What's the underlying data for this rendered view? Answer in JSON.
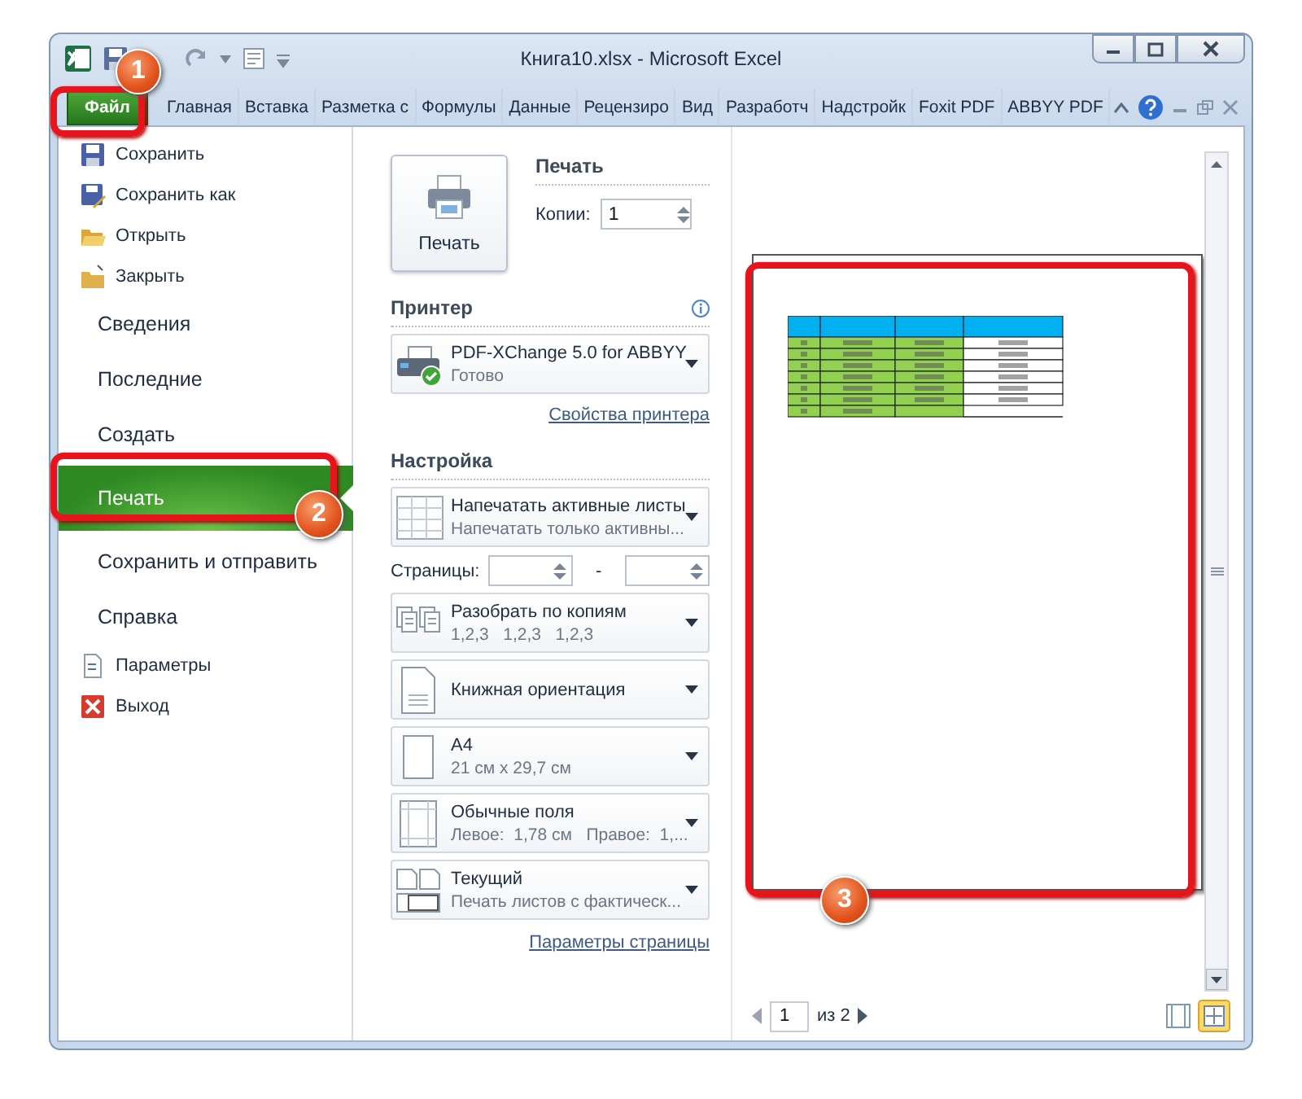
{
  "window": {
    "title": "Книга10.xlsx - Microsoft Excel"
  },
  "ribbon_tabs": [
    {
      "label": "Файл",
      "selected": true
    },
    {
      "label": "Главная",
      "selected": false
    },
    {
      "label": "Вставка",
      "selected": false
    },
    {
      "label": "Разметка с",
      "selected": false
    },
    {
      "label": "Формулы",
      "selected": false
    },
    {
      "label": "Данные",
      "selected": false
    },
    {
      "label": "Рецензиро",
      "selected": false
    },
    {
      "label": "Вид",
      "selected": false
    },
    {
      "label": "Разработч",
      "selected": false
    },
    {
      "label": "Надстройк",
      "selected": false
    },
    {
      "label": "Foxit PDF",
      "selected": false
    },
    {
      "label": "ABBYY PDF",
      "selected": false
    }
  ],
  "backstage_nav": [
    {
      "kind": "command",
      "label": "Сохранить",
      "selected": false
    },
    {
      "kind": "command",
      "label": "Сохранить как",
      "selected": false
    },
    {
      "kind": "command",
      "label": "Открыть",
      "selected": false
    },
    {
      "kind": "command",
      "label": "Закрыть",
      "selected": false
    },
    {
      "kind": "section",
      "label": "Сведения",
      "selected": false
    },
    {
      "kind": "section",
      "label": "Последние",
      "selected": false
    },
    {
      "kind": "section",
      "label": "Создать",
      "selected": false
    },
    {
      "kind": "section",
      "label": "Печать",
      "selected": true
    },
    {
      "kind": "section",
      "label": "Сохранить и отправить",
      "selected": false
    },
    {
      "kind": "section",
      "label": "Справка",
      "selected": false
    },
    {
      "kind": "command",
      "label": "Параметры",
      "selected": false
    },
    {
      "kind": "command",
      "label": "Выход",
      "selected": false
    }
  ],
  "print": {
    "button": "Печать",
    "heading": "Печать",
    "copies_label": "Копии:",
    "copies": "1"
  },
  "printer": {
    "heading": "Принтер",
    "name": "PDF-XChange 5.0 for ABBYY",
    "status": "Готово",
    "properties_link": "Свойства принтера"
  },
  "settings": {
    "heading": "Настройка",
    "items": [
      {
        "kind": "dropdown",
        "title": "Напечатать активные листы",
        "subtitle": "Напечатать только активны..."
      },
      {
        "kind": "pages",
        "label": "Страницы:",
        "separator": "-"
      },
      {
        "kind": "dropdown",
        "title": "Разобрать по копиям",
        "subtitle": "1,2,3   1,2,3   1,2,3"
      },
      {
        "kind": "dropdown",
        "title": "Книжная ориентация"
      },
      {
        "kind": "dropdown",
        "title": "A4",
        "subtitle": "21 см x 29,7 см"
      },
      {
        "kind": "dropdown",
        "title": "Обычные поля",
        "subtitle": "Левое:  1,78 см   Правое:  1,..."
      },
      {
        "kind": "dropdown",
        "title": "Текущий",
        "subtitle": "Печать листов с фактическ..."
      }
    ],
    "page_setup_link": "Параметры страницы"
  },
  "preview": {
    "page": "1",
    "of": "из 2"
  },
  "callouts": [
    "1",
    "2",
    "3"
  ]
}
